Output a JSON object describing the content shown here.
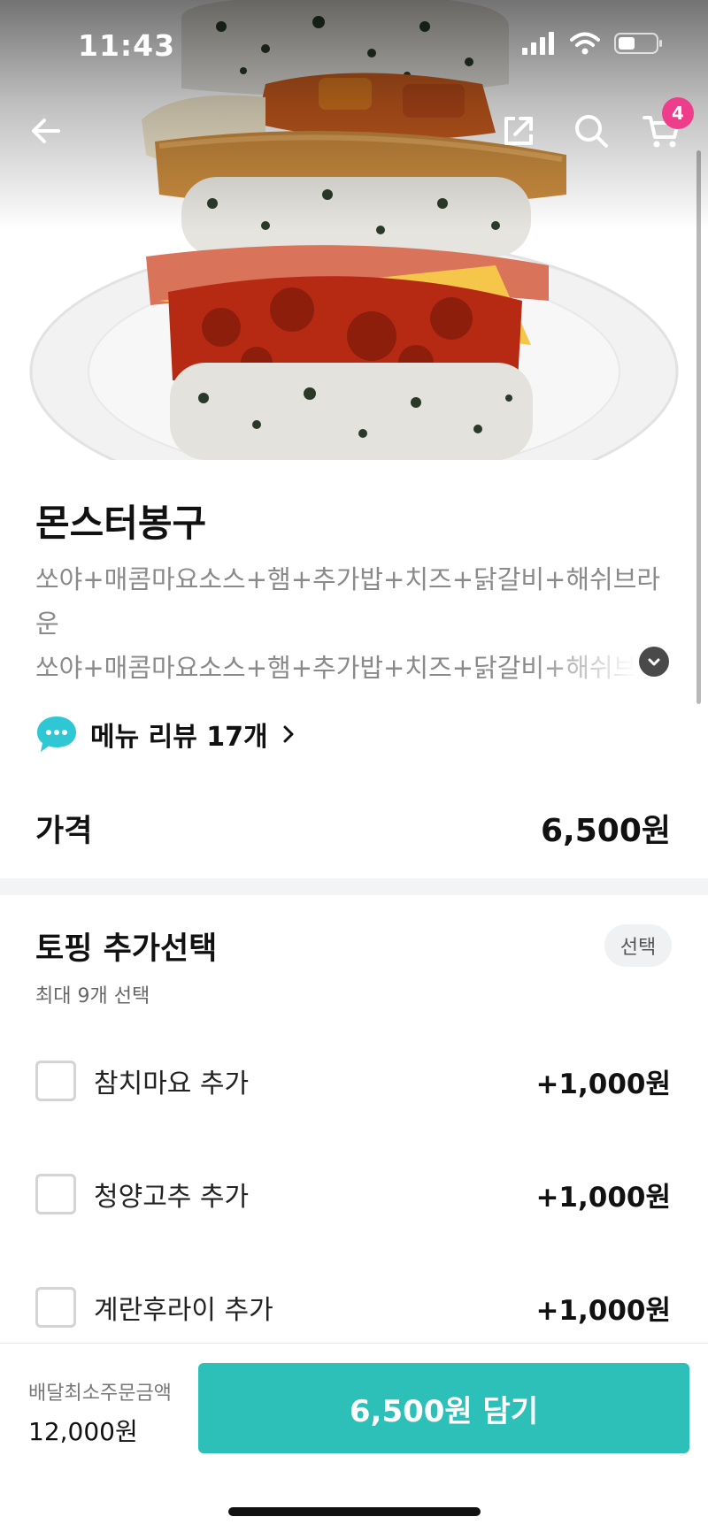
{
  "status_bar": {
    "time": "11:43"
  },
  "nav": {
    "cart_count": "4"
  },
  "icons": [
    "back-arrow-icon",
    "share-icon",
    "search-icon",
    "cart-icon",
    "chevron-down-icon",
    "chat-bubble-icon",
    "chevron-right-icon"
  ],
  "menu": {
    "name": "몬스터봉구",
    "description_lines": [
      "쏘야+매콤마요소스+햄+추가밥+치즈+닭갈비+해쉬브라",
      "운",
      "쏘야+매콤마요소스+햄+추가밥+치즈+닭갈비+해쉬브라운"
    ],
    "review_label": "메뉴 리뷰 17개"
  },
  "price": {
    "label": "가격",
    "value": "6,500원"
  },
  "toppings": {
    "title": "토핑 추가선택",
    "badge": "선택",
    "subtitle": "최대 9개 선택",
    "options": [
      {
        "label": "참치마요 추가",
        "price": "+1,000원"
      },
      {
        "label": "청양고추 추가",
        "price": "+1,000원"
      },
      {
        "label": "계란후라이 추가",
        "price": "+1,000원"
      }
    ]
  },
  "bottom": {
    "min_order_label": "배달최소주문금액",
    "min_order_value": "12,000원",
    "add_button": "6,500원 담기"
  },
  "colors": {
    "accent": "#2cc0b8",
    "badge": "#ee3d8a",
    "review_icon": "#2fc7d3"
  }
}
